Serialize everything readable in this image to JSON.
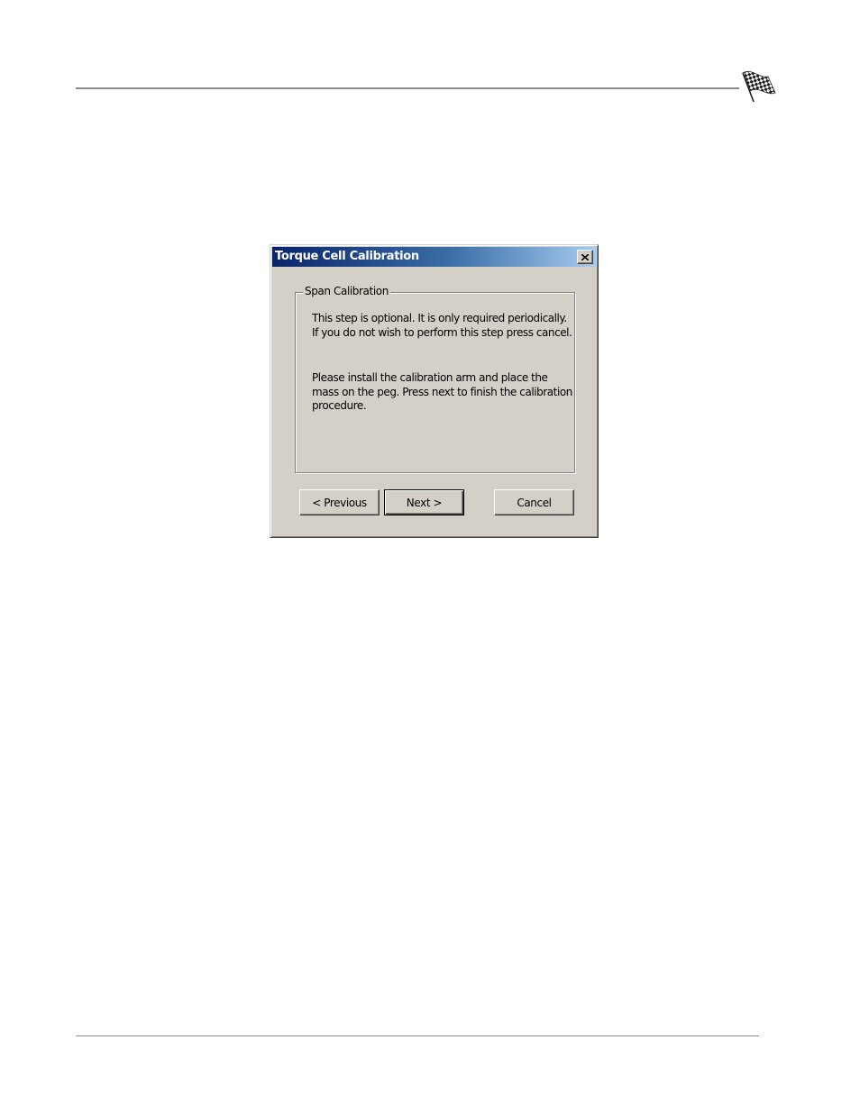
{
  "dialog": {
    "title": "Torque Cell Calibration",
    "group_label": "Span Calibration",
    "paragraph_1": "This step is optional.  It is only required periodically.  If you do not wish to perform this step press cancel.",
    "paragraph_2": "Please install the calibration arm and place the mass on the peg.  Press next to finish the calibration procedure.",
    "buttons": {
      "previous": "< Previous",
      "next": "Next >",
      "cancel": "Cancel"
    }
  },
  "icons": {
    "header": "checkered-flag-icon",
    "close": "close-icon"
  }
}
